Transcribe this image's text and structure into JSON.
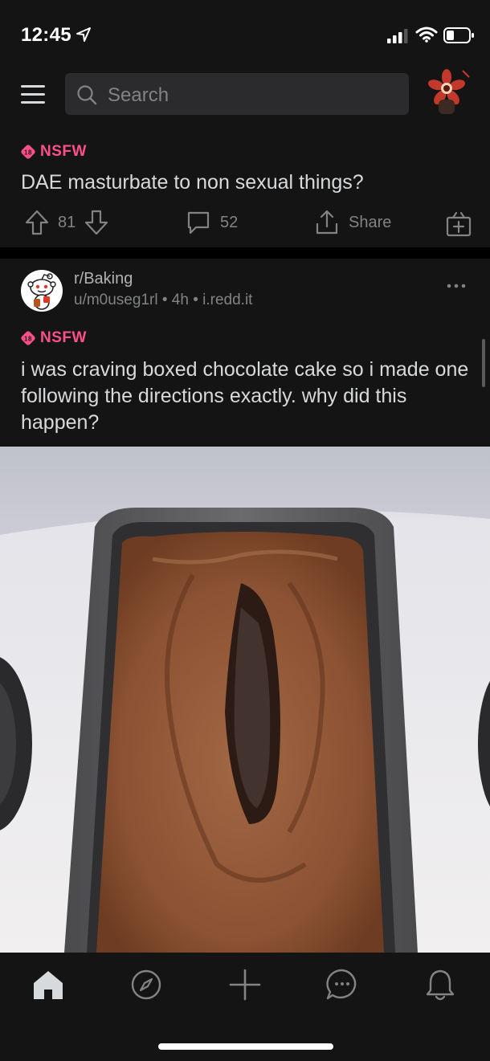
{
  "status_bar": {
    "time": "12:45"
  },
  "header": {
    "search_placeholder": "Search"
  },
  "post1": {
    "nsfw_label": "NSFW",
    "title": "DAE masturbate to non sexual things?",
    "upvotes": "81",
    "comments": "52",
    "share_label": "Share"
  },
  "post2": {
    "subreddit": "r/Baking",
    "author": "u/m0useg1rl",
    "age": "4h",
    "domain": "i.redd.it",
    "nsfw_label": "NSFW",
    "title": "i was craving boxed chocolate cake so i made one following the directions exactly. why did this happen?"
  },
  "colors": {
    "accent_nsfw": "#ff4f8b",
    "background": "#141414",
    "text": "#d7dadc",
    "muted": "#818384"
  },
  "tab_bar": {
    "tabs": [
      "home-icon",
      "compass-icon",
      "plus-icon",
      "chat-icon",
      "bell-icon"
    ]
  }
}
